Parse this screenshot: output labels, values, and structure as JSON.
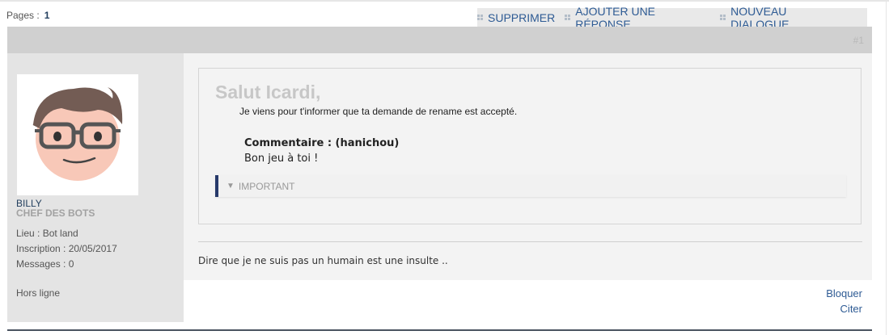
{
  "pagination": {
    "label": "Pages :",
    "current": "1"
  },
  "actions": [
    {
      "label": "SUPPRIMER"
    },
    {
      "label": "AJOUTER UNE RÉPONSE"
    },
    {
      "label": "NOUVEAU DIALOGUE"
    }
  ],
  "post": {
    "number": "#1",
    "author": {
      "username": "BILLY",
      "rank": "CHEF DES BOTS",
      "location": "Lieu : Bot land",
      "registered": "Inscription : 20/05/2017",
      "messages": "Messages : 0",
      "status": "Hors ligne"
    },
    "message": {
      "title": "Salut Icardi,",
      "line": "Je viens pour t'informer que ta demande de rename est accepté.",
      "comment_label": "Commentaire : (hanichou)",
      "comment_text": "Bon jeu à toi !",
      "spoiler_label": "IMPORTANT"
    },
    "signature": "Dire que je ne suis pas un humain est une insulte ..",
    "footer_links": {
      "block": "Bloquer",
      "quote": "Citer"
    }
  },
  "colors": {
    "link": "#2e5b94",
    "header_bar": "#d0d0d0",
    "sidebar": "#e4e4e4",
    "spoiler_border": "#26396a"
  }
}
